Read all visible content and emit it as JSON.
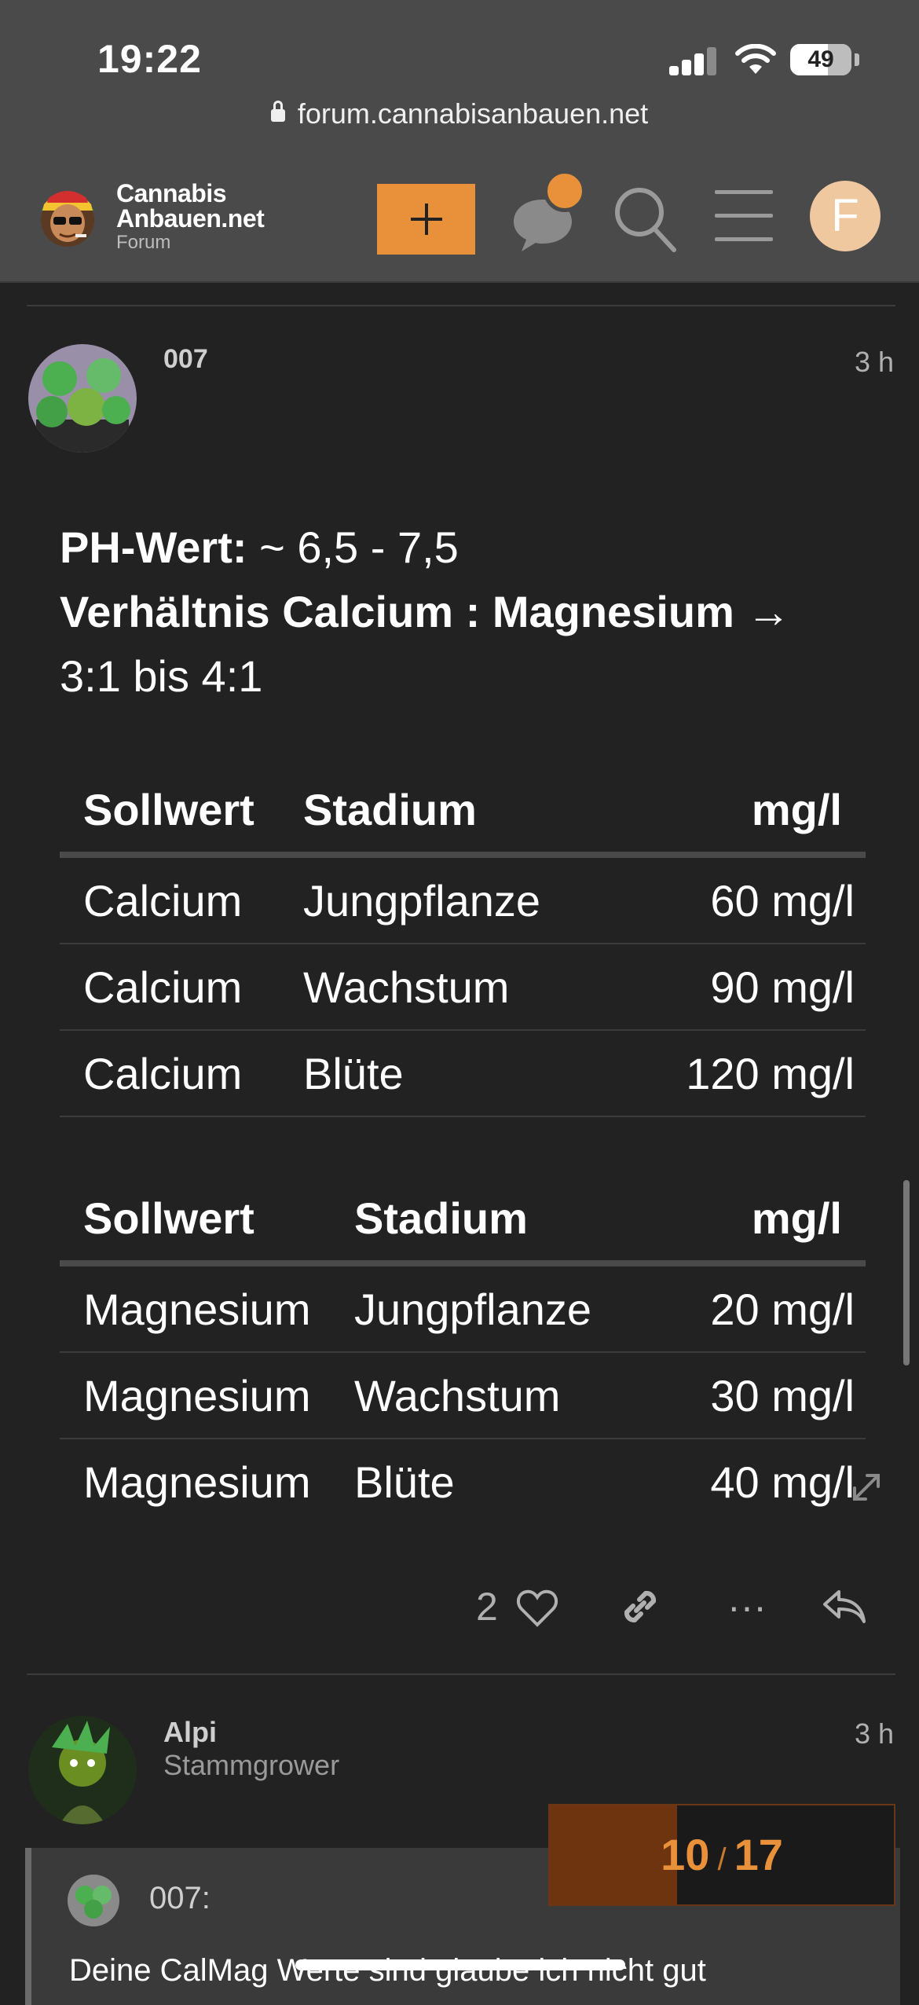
{
  "status_bar": {
    "time": "19:22",
    "battery": "49"
  },
  "browser": {
    "url": "forum.cannabisanbauen.net"
  },
  "site_header": {
    "logo_line1": "Cannabis",
    "logo_line2": "Anbauen.net",
    "logo_line3": "Forum",
    "user_initial": "F",
    "accent_color": "#e8913a"
  },
  "post1": {
    "username": "007",
    "time": "3 h",
    "ph_label": "PH-Wert:",
    "ph_value": " ~ 6,5 - 7,5",
    "ratio_label": "Verhältnis Calcium : Magnesium",
    "ratio_arrow": " →",
    "ratio_value": "3:1 bis 4:1",
    "table1": {
      "headers": [
        "Sollwert",
        "Stadium",
        "mg/l"
      ],
      "rows": [
        [
          "Calcium",
          "Jungpflanze",
          "60 mg/l"
        ],
        [
          "Calcium",
          "Wachstum",
          "90 mg/l"
        ],
        [
          "Calcium",
          "Blüte",
          "120 mg/l"
        ]
      ]
    },
    "table2": {
      "headers": [
        "Sollwert",
        "Stadium",
        "mg/l"
      ],
      "rows": [
        [
          "Magnesium",
          "Jungpflanze",
          "20 mg/l"
        ],
        [
          "Magnesium",
          "Wachstum",
          "30 mg/l"
        ],
        [
          "Magnesium",
          "Blüte",
          "40 mg/l"
        ]
      ]
    },
    "likes": "2",
    "more": "···"
  },
  "post2": {
    "username": "Alpi",
    "user_title": "Stammgrower",
    "time": "3 h",
    "quote_username": "007:",
    "quote_text": "Deine CalMag Werte sind glaube ich nicht gut"
  },
  "progress": {
    "current": "10",
    "separator": "/",
    "total": "17",
    "fraction": 0.37
  }
}
